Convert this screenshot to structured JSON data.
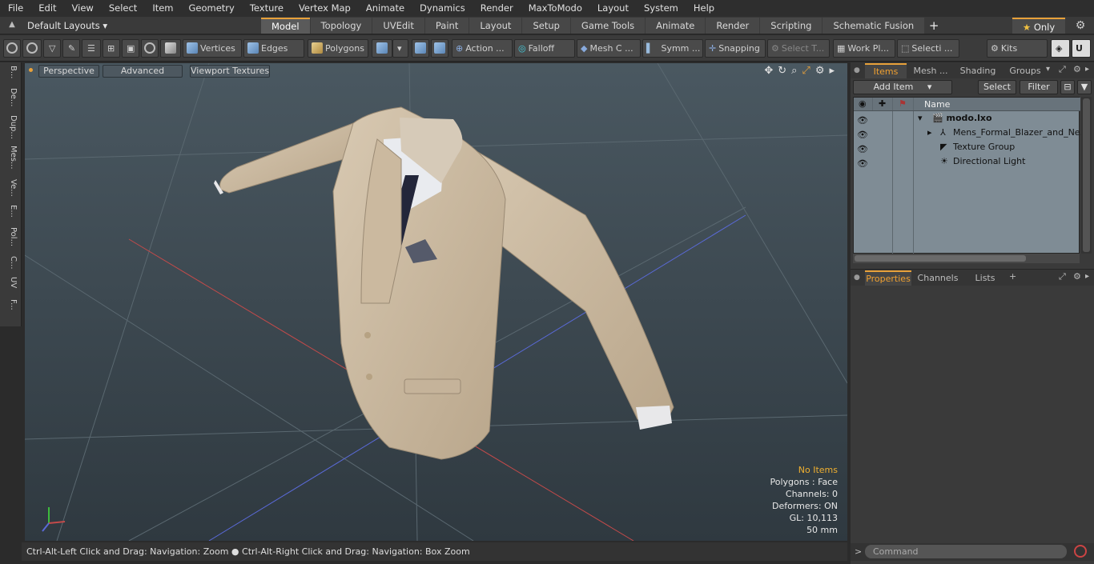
{
  "menu": [
    "File",
    "Edit",
    "View",
    "Select",
    "Item",
    "Geometry",
    "Texture",
    "Vertex Map",
    "Animate",
    "Dynamics",
    "Render",
    "MaxToModo",
    "Layout",
    "System",
    "Help"
  ],
  "layout": {
    "default_layouts": "Default Layouts",
    "tabs": [
      "Model",
      "Topology",
      "UVEdit",
      "Paint",
      "Layout",
      "Setup",
      "Game Tools",
      "Animate",
      "Render",
      "Scripting",
      "Schematic Fusion"
    ],
    "active_tab": "Model",
    "only_label": "Only"
  },
  "toolbar": {
    "vertices": "Vertices",
    "edges": "Edges",
    "polygons": "Polygons",
    "action": "Action",
    "falloff": "Falloff",
    "mesh_c": "Mesh C ...",
    "symm": "Symm ...",
    "snapping": "Snapping",
    "select_t": "Select T...",
    "work_pl": "Work Pl...",
    "selecti": "Selecti ...",
    "kits": "Kits"
  },
  "left_tabs": [
    "B...",
    "De...",
    "Dup...",
    "Mes...",
    "Ve...",
    "E...",
    "Pol...",
    "C...",
    "UV",
    "F..."
  ],
  "viewport": {
    "perspective": "Perspective",
    "advanced": "Advanced",
    "viewport_textures": "Viewport Textures",
    "info": {
      "no_items": "No Items",
      "polygons": "Polygons : Face",
      "channels": "Channels: 0",
      "deformers": "Deformers: ON",
      "gl": "GL: 10,113",
      "mm": "50 mm"
    }
  },
  "status": {
    "left": "Ctrl-Alt-Left Click and Drag: Navigation: Zoom",
    "right": "Ctrl-Alt-Right Click and Drag: Navigation: Box Zoom"
  },
  "items_panel": {
    "tabs": [
      "Items",
      "Mesh ...",
      "Shading",
      "Groups"
    ],
    "add_item": "Add Item",
    "select": "Select",
    "filter": "Filter",
    "name_header": "Name",
    "rows": [
      "modo.lxo",
      "Mens_Formal_Blazer_and_Ne...",
      "Texture Group",
      "Directional Light"
    ]
  },
  "props_panel": {
    "tabs": [
      "Properties",
      "Channels",
      "Lists"
    ]
  },
  "command": {
    "placeholder": "Command"
  },
  "colors": {
    "accent": "#e8a13a",
    "viewport_bg": "#3e4a52",
    "jacket": "#c8b8a0"
  }
}
